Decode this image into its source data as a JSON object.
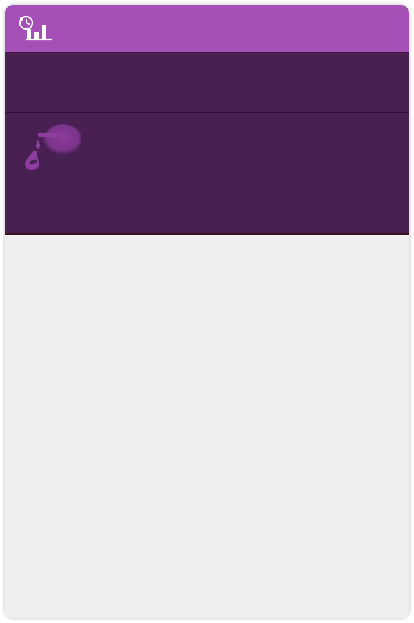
{
  "app": {
    "header_icon": "history-chart-icon",
    "reading_icon": "glucose-meter-icon"
  },
  "colors": {
    "header": "#a550b6",
    "band": "#482152",
    "body": "#efefef",
    "icon_light": "#ffffff",
    "icon_muted": "#8e3d9f"
  }
}
